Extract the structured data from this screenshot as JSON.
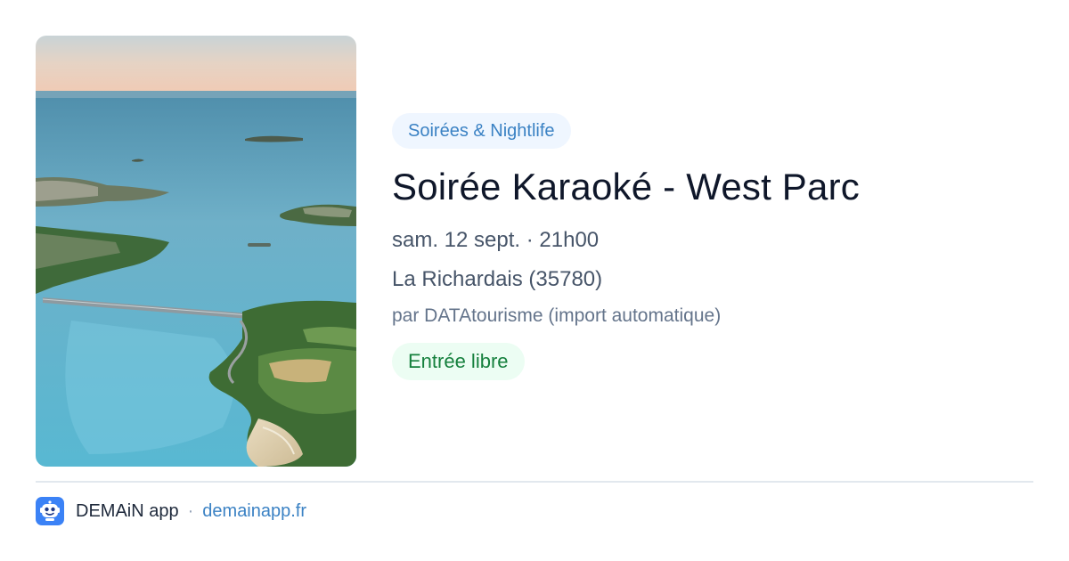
{
  "event": {
    "image_icon": "coastal-aerial-photo",
    "category": "Soirées & Nightlife",
    "title": "Soirée Karaoké - West Parc",
    "datetime": "sam. 12 sept. · 21h00",
    "location": "La Richardais (35780)",
    "source": "par DATAtourisme (import automatique)",
    "price": "Entrée libre"
  },
  "footer": {
    "logo_icon": "demain-robot-icon",
    "app_name": "DEMAiN app",
    "separator": "·",
    "link": "demainapp.fr"
  },
  "colors": {
    "category_bg": "#eff6ff",
    "category_text": "#3b82c4",
    "price_bg": "#ecfdf3",
    "price_text": "#15803d",
    "link": "#3b82c4",
    "logo_bg": "#3b82f6"
  }
}
